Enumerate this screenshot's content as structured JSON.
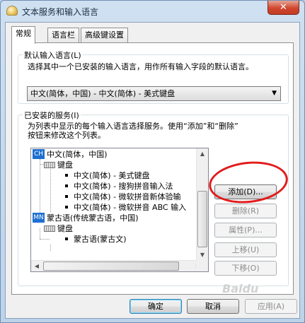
{
  "window": {
    "title": "文本服务和输入语言",
    "close_label": "✕"
  },
  "tabs": [
    {
      "label": "常规"
    },
    {
      "label": "语言栏"
    },
    {
      "label": "高级键设置"
    }
  ],
  "default_input": {
    "group_title": "默认输入语言(L)",
    "description": "选择其中一个已安装的输入语言，用作所有输入字段的默认语言。",
    "selected": "中文(简体，中国) - 中文(简体) - 美式键盘"
  },
  "installed": {
    "group_title": "已安装的服务(I)",
    "description_line1": "为列表中显示的每个输入语言选择服务。使用“添加”和“删除”",
    "description_line2": "按钮来修改这个列表。",
    "tree": {
      "lang1_code": "CH",
      "lang1_name": "中文(简体，中国)",
      "lang1_keyboard": "键盘",
      "lang1_items": [
        "中文(简体) - 美式键盘",
        "中文(简体) - 搜狗拼音输入法",
        "中文(简体) - 微软拼音新体验输",
        "中文(简体) - 微软拼音 ABC 输入"
      ],
      "lang2_code": "MN",
      "lang2_name": "蒙古语(传统蒙古语，中国)",
      "lang2_keyboard": "键盘",
      "lang2_items": [
        "蒙古语(蒙古文)"
      ]
    },
    "buttons": {
      "add": "添加(D)...",
      "remove": "删除(R)",
      "properties": "属性(P)...",
      "move_up": "上移(U)",
      "move_down": "下移(O)"
    }
  },
  "footer": {
    "ok": "确定",
    "cancel": "取消",
    "apply": "应用(A)"
  },
  "watermark": "Baidu"
}
